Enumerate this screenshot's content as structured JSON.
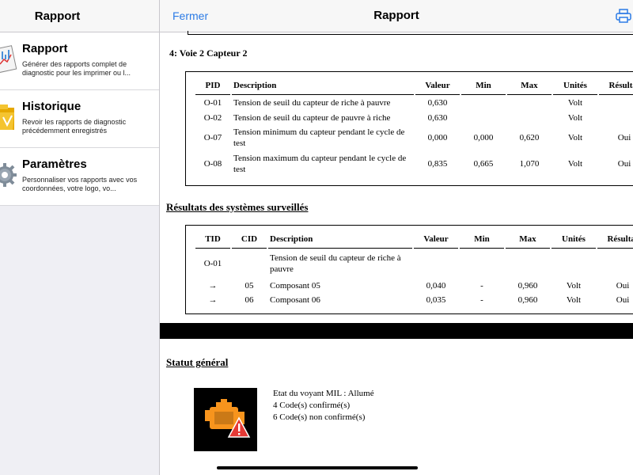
{
  "sidebar": {
    "title": "Rapport",
    "items": [
      {
        "name": "Rapport",
        "desc": "Générer des rapports complet de diagnostic pour les imprimer ou l..."
      },
      {
        "name": "Historique",
        "desc": "Revoir les rapports de diagnostic précédemment enregistrés"
      },
      {
        "name": "Paramètres",
        "desc": "Personnaliser vos rapports avec vos coordonnées, votre logo, vo..."
      }
    ]
  },
  "header": {
    "close_label": "Fermer",
    "title": "Rapport"
  },
  "section1": {
    "title": "4: Voie 2 Capteur 2",
    "headers": [
      "PID",
      "Description",
      "Valeur",
      "Min",
      "Max",
      "Unités",
      "Résultat"
    ],
    "rows": [
      [
        "O-01",
        "Tension de seuil du capteur de riche à pauvre",
        "0,630",
        "",
        "",
        "Volt",
        ""
      ],
      [
        "O-02",
        "Tension de seuil du capteur de pauvre à riche",
        "0,630",
        "",
        "",
        "Volt",
        ""
      ],
      [
        "O-07",
        "Tension minimum du capteur pendant le cycle de test",
        "0,000",
        "0,000",
        "0,620",
        "Volt",
        "Oui"
      ],
      [
        "O-08",
        "Tension maximum du capteur pendant le cycle de test",
        "0,835",
        "0,665",
        "1,070",
        "Volt",
        "Oui"
      ]
    ]
  },
  "section2": {
    "title": "Résultats des systèmes surveillés",
    "headers": [
      "TID",
      "CID",
      "Description",
      "Valeur",
      "Min",
      "Max",
      "Unités",
      "Résultat"
    ],
    "rows": [
      [
        "O-01",
        "",
        "Tension de seuil du capteur de riche à pauvre",
        "",
        "",
        "",
        "",
        ""
      ],
      [
        "→",
        "05",
        "Composant 05",
        "0,040",
        "-",
        "0,960",
        "Volt",
        "Oui"
      ],
      [
        "→",
        "06",
        "Composant 06",
        "0,035",
        "-",
        "0,960",
        "Volt",
        "Oui"
      ]
    ]
  },
  "status": {
    "title": "Statut général",
    "lines": [
      "Etat du voyant MIL : Allumé",
      "4 Code(s) confirmé(s)",
      "6 Code(s) non confirmé(s)"
    ]
  },
  "icons": {
    "printer": "printer-icon",
    "engine": "check-engine-icon"
  },
  "colors": {
    "accent": "#2c7be5",
    "engine_orange": "#f7941d",
    "warning_red": "#e53935"
  }
}
